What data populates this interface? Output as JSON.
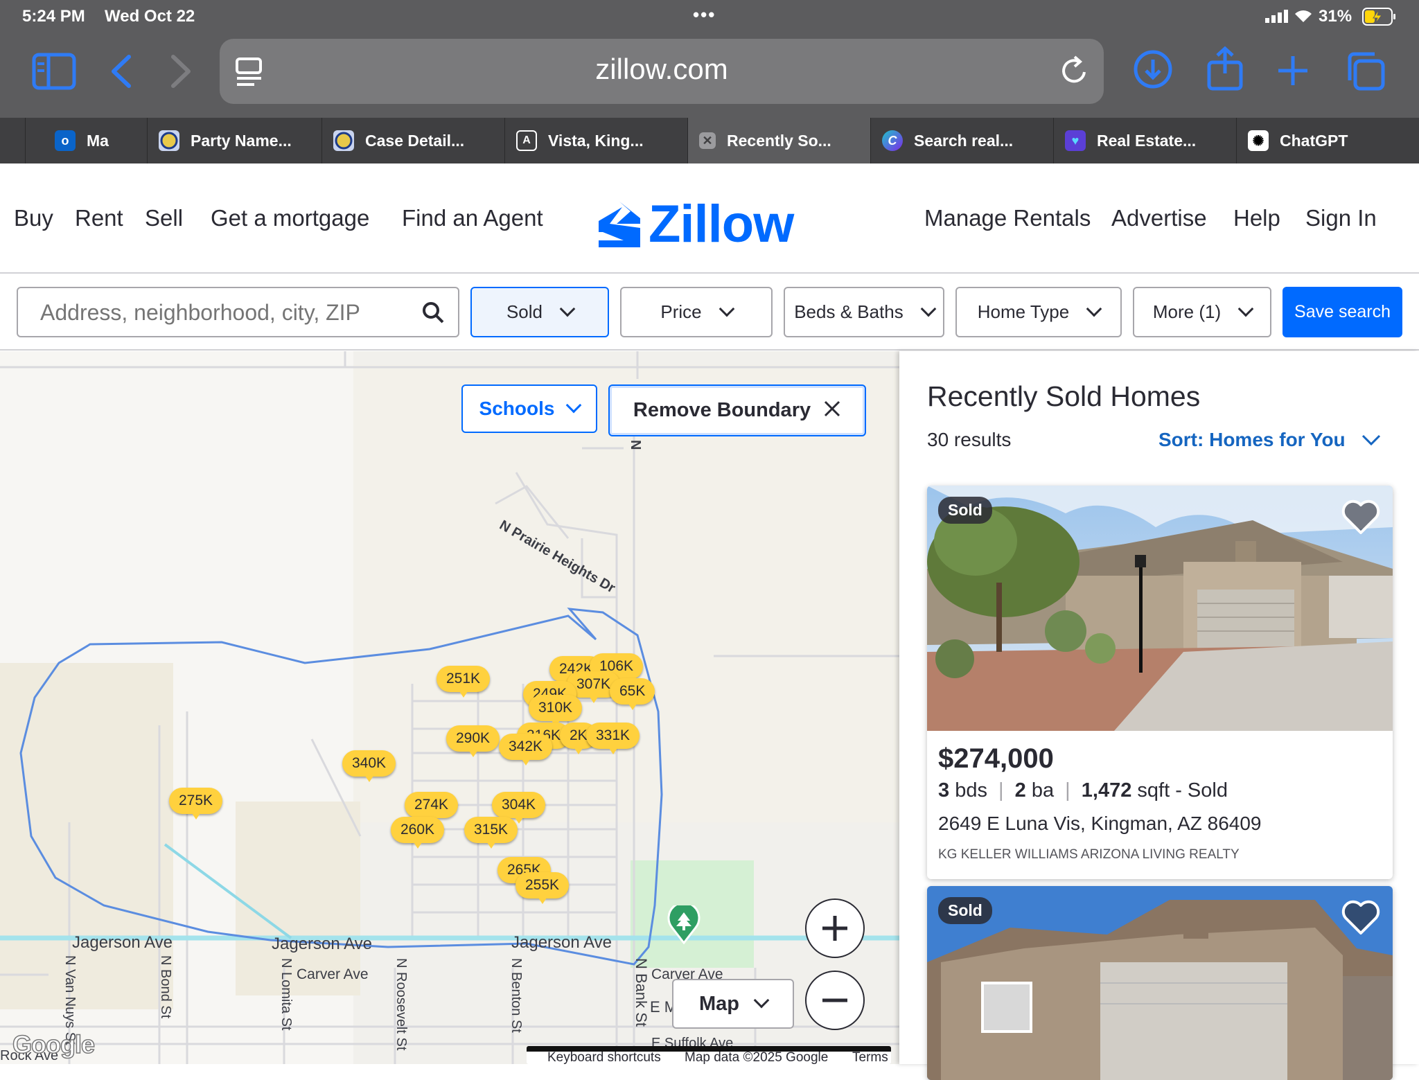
{
  "status_bar": {
    "time": "5:24 PM",
    "date": "Wed Oct 22",
    "dots": "•••",
    "battery": "31%"
  },
  "browser": {
    "url": "zillow.com",
    "tabs": [
      {
        "label": "Ma",
        "icon": "outlook-icon"
      },
      {
        "label": "Party Name...",
        "icon": "court-seal-icon"
      },
      {
        "label": "Case Detail...",
        "icon": "court-seal-icon"
      },
      {
        "label": "Vista, King...",
        "icon": "letter-a-icon"
      },
      {
        "label": "Recently So...",
        "icon": "close-tab-icon",
        "active": true
      },
      {
        "label": "Search real...",
        "icon": "canva-icon"
      },
      {
        "label": "Real Estate...",
        "icon": "heart-shield-icon"
      },
      {
        "label": "ChatGPT",
        "icon": "chatgpt-icon"
      }
    ]
  },
  "header": {
    "nav_left": [
      "Buy",
      "Rent",
      "Sell",
      "Get a mortgage",
      "Find an Agent"
    ],
    "logo": "Zillow",
    "nav_right": [
      "Manage Rentals",
      "Advertise",
      "Help",
      "Sign In"
    ]
  },
  "filters": {
    "search_placeholder": "Address, neighborhood, city, ZIP",
    "sold": "Sold",
    "price": "Price",
    "beds": "Beds & Baths",
    "home_type": "Home Type",
    "more": "More (1)",
    "save": "Save search"
  },
  "map": {
    "schools": "Schools",
    "remove_boundary": "Remove Boundary",
    "map_type": "Map",
    "google": "Google",
    "footer": [
      "Keyboard shortcuts",
      "Map data ©2025 Google",
      "Terms"
    ],
    "pins": [
      "242K",
      "106K",
      "307K",
      "249K",
      "65K",
      "310K",
      "251K",
      "290K",
      "316K",
      "342K",
      "2K",
      "331K",
      "340K",
      "275K",
      "274K",
      "304K",
      "260K",
      "315K",
      "265K",
      "255K"
    ],
    "streets": [
      "N Prairie Heights Dr",
      "Jagerson Ave",
      "Jagerson Ave",
      "Jagerson Ave",
      "Carver Ave",
      "Carver Ave",
      "N Van Nuys St",
      "N Bond St",
      "N Lomita St",
      "N Roosevelt St",
      "N Benton St",
      "N Bank St",
      "E M",
      "E Suffolk Ave",
      "Rock Ave",
      "N"
    ]
  },
  "results": {
    "title": "Recently Sold Homes",
    "count": "30 results",
    "sort": "Sort: Homes for You",
    "listings": [
      {
        "tag": "Sold",
        "price": "$274,000",
        "beds": "3",
        "beds_unit": "bds",
        "baths": "2",
        "baths_unit": "ba",
        "sqft": "1,472",
        "sqft_unit": "sqft - Sold",
        "address": "2649 E Luna Vis, Kingman, AZ 86409",
        "broker": "KG KELLER WILLIAMS ARIZONA LIVING REALTY"
      },
      {
        "tag": "Sold"
      }
    ]
  },
  "colors": {
    "accent": "#006aff",
    "pin": "#ffd13e",
    "boundary": "#5b8de0"
  }
}
